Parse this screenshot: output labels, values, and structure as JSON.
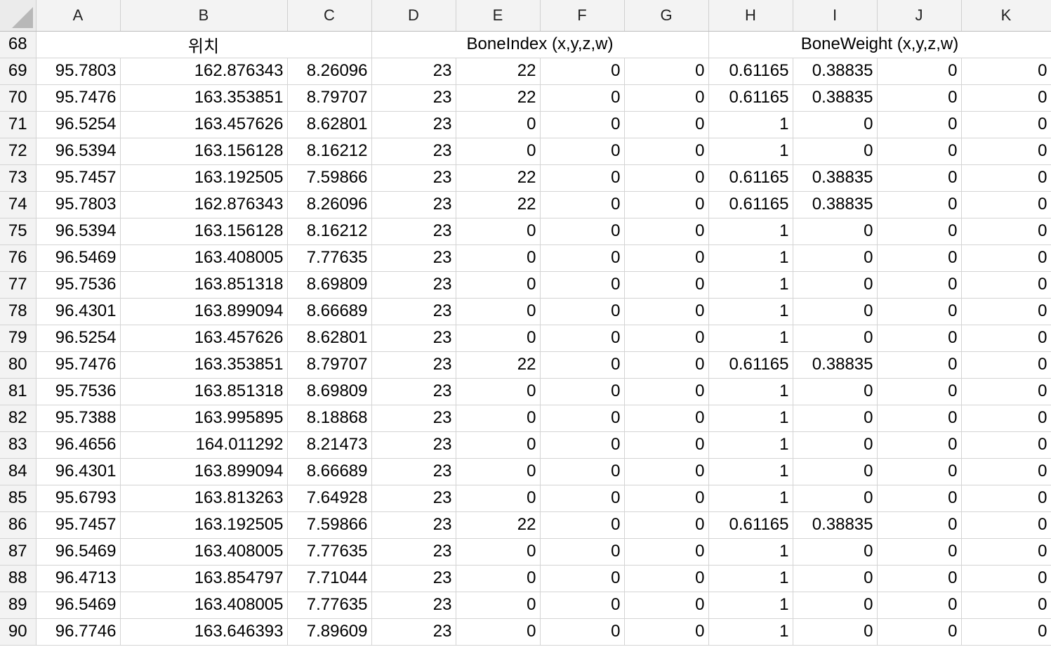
{
  "columns": [
    "A",
    "B",
    "C",
    "D",
    "E",
    "F",
    "G",
    "H",
    "I",
    "J",
    "K"
  ],
  "header_row": {
    "row_number": "68",
    "position_label": "위치",
    "bone_index_label": "BoneIndex (x,y,z,w)",
    "bone_weight_label": "BoneWeight (x,y,z,w)"
  },
  "rows": [
    {
      "n": "69",
      "cells": [
        "95.7803",
        "162.876343",
        "8.26096",
        "23",
        "22",
        "0",
        "0",
        "0.61165",
        "0.38835",
        "0",
        "0"
      ]
    },
    {
      "n": "70",
      "cells": [
        "95.7476",
        "163.353851",
        "8.79707",
        "23",
        "22",
        "0",
        "0",
        "0.61165",
        "0.38835",
        "0",
        "0"
      ]
    },
    {
      "n": "71",
      "cells": [
        "96.5254",
        "163.457626",
        "8.62801",
        "23",
        "0",
        "0",
        "0",
        "1",
        "0",
        "0",
        "0"
      ]
    },
    {
      "n": "72",
      "cells": [
        "96.5394",
        "163.156128",
        "8.16212",
        "23",
        "0",
        "0",
        "0",
        "1",
        "0",
        "0",
        "0"
      ]
    },
    {
      "n": "73",
      "cells": [
        "95.7457",
        "163.192505",
        "7.59866",
        "23",
        "22",
        "0",
        "0",
        "0.61165",
        "0.38835",
        "0",
        "0"
      ]
    },
    {
      "n": "74",
      "cells": [
        "95.7803",
        "162.876343",
        "8.26096",
        "23",
        "22",
        "0",
        "0",
        "0.61165",
        "0.38835",
        "0",
        "0"
      ]
    },
    {
      "n": "75",
      "cells": [
        "96.5394",
        "163.156128",
        "8.16212",
        "23",
        "0",
        "0",
        "0",
        "1",
        "0",
        "0",
        "0"
      ]
    },
    {
      "n": "76",
      "cells": [
        "96.5469",
        "163.408005",
        "7.77635",
        "23",
        "0",
        "0",
        "0",
        "1",
        "0",
        "0",
        "0"
      ]
    },
    {
      "n": "77",
      "cells": [
        "95.7536",
        "163.851318",
        "8.69809",
        "23",
        "0",
        "0",
        "0",
        "1",
        "0",
        "0",
        "0"
      ]
    },
    {
      "n": "78",
      "cells": [
        "96.4301",
        "163.899094",
        "8.66689",
        "23",
        "0",
        "0",
        "0",
        "1",
        "0",
        "0",
        "0"
      ]
    },
    {
      "n": "79",
      "cells": [
        "96.5254",
        "163.457626",
        "8.62801",
        "23",
        "0",
        "0",
        "0",
        "1",
        "0",
        "0",
        "0"
      ]
    },
    {
      "n": "80",
      "cells": [
        "95.7476",
        "163.353851",
        "8.79707",
        "23",
        "22",
        "0",
        "0",
        "0.61165",
        "0.38835",
        "0",
        "0"
      ]
    },
    {
      "n": "81",
      "cells": [
        "95.7536",
        "163.851318",
        "8.69809",
        "23",
        "0",
        "0",
        "0",
        "1",
        "0",
        "0",
        "0"
      ]
    },
    {
      "n": "82",
      "cells": [
        "95.7388",
        "163.995895",
        "8.18868",
        "23",
        "0",
        "0",
        "0",
        "1",
        "0",
        "0",
        "0"
      ]
    },
    {
      "n": "83",
      "cells": [
        "96.4656",
        "164.011292",
        "8.21473",
        "23",
        "0",
        "0",
        "0",
        "1",
        "0",
        "0",
        "0"
      ]
    },
    {
      "n": "84",
      "cells": [
        "96.4301",
        "163.899094",
        "8.66689",
        "23",
        "0",
        "0",
        "0",
        "1",
        "0",
        "0",
        "0"
      ]
    },
    {
      "n": "85",
      "cells": [
        "95.6793",
        "163.813263",
        "7.64928",
        "23",
        "0",
        "0",
        "0",
        "1",
        "0",
        "0",
        "0"
      ]
    },
    {
      "n": "86",
      "cells": [
        "95.7457",
        "163.192505",
        "7.59866",
        "23",
        "22",
        "0",
        "0",
        "0.61165",
        "0.38835",
        "0",
        "0"
      ]
    },
    {
      "n": "87",
      "cells": [
        "96.5469",
        "163.408005",
        "7.77635",
        "23",
        "0",
        "0",
        "0",
        "1",
        "0",
        "0",
        "0"
      ]
    },
    {
      "n": "88",
      "cells": [
        "96.4713",
        "163.854797",
        "7.71044",
        "23",
        "0",
        "0",
        "0",
        "1",
        "0",
        "0",
        "0"
      ]
    },
    {
      "n": "89",
      "cells": [
        "96.5469",
        "163.408005",
        "7.77635",
        "23",
        "0",
        "0",
        "0",
        "1",
        "0",
        "0",
        "0"
      ]
    },
    {
      "n": "90",
      "cells": [
        "96.7746",
        "163.646393",
        "7.89609",
        "23",
        "0",
        "0",
        "0",
        "1",
        "0",
        "0",
        "0"
      ]
    }
  ]
}
